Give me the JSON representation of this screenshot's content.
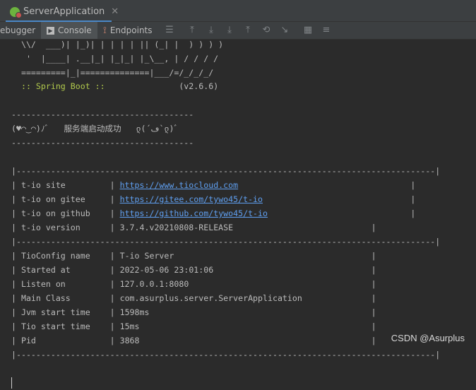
{
  "run_tab": {
    "title": "ServerApplication",
    "close_symbol": "✕"
  },
  "toolbar": {
    "debugger_label": "ebugger",
    "console_label": "Console",
    "endpoints_label": "Endpoints",
    "icons": [
      "menu-icon",
      "scroll-to-end-icon",
      "download-icon",
      "download-alt-icon",
      "upload-icon",
      "restore-icon",
      "clear-icon",
      "grid-icon",
      "settings-icon"
    ]
  },
  "banner": {
    "ascii_1": "  \\\\/  ___)| |_)| | | | | || (_| |  ) ) ) )",
    "ascii_2": "   '  |____| .__|_| |_|_| |_\\__, | / / / /",
    "ascii_3": "  =========|_|==============|___/=/_/_/_/",
    "spring_boot": "  :: Spring Boot ::",
    "spring_version": "(v2.6.6)"
  },
  "startup": {
    "divider": "-------------------------------------",
    "kaomoji": "(♥◠‿◠)ﾉﾞ",
    "message": "服务端启动成功",
    "kaomoji2": "ლ(´ڡ`ლ)ﾞ"
  },
  "tio_table": {
    "border": "|-------------------------------------------------------------------------------------|",
    "site_label": "t-io site",
    "site_url": "https://www.tiocloud.com",
    "gitee_label": "t-io on gitee",
    "gitee_url": "https://gitee.com/tywo45/t-io",
    "github_label": "t-io on github",
    "github_url": "https://github.com/tywo45/t-io",
    "version_label": "t-io version",
    "version_value": "3.7.4.v20210808-RELEASE",
    "config_name_label": "TioConfig name",
    "config_name_value": "T-io Server",
    "started_label": "Started at",
    "started_value": "2022-05-06 23:01:06",
    "listen_label": "Listen on",
    "listen_value": "127.0.0.1:8080",
    "main_class_label": "Main Class",
    "main_class_value": "com.asurplus.server.ServerApplication",
    "jvm_label": "Jvm start time",
    "jvm_value": "1598ms",
    "tio_start_label": "Tio start time",
    "tio_start_value": "15ms",
    "pid_label": "Pid",
    "pid_value": "3868"
  },
  "watermark": "CSDN @Asurplus"
}
